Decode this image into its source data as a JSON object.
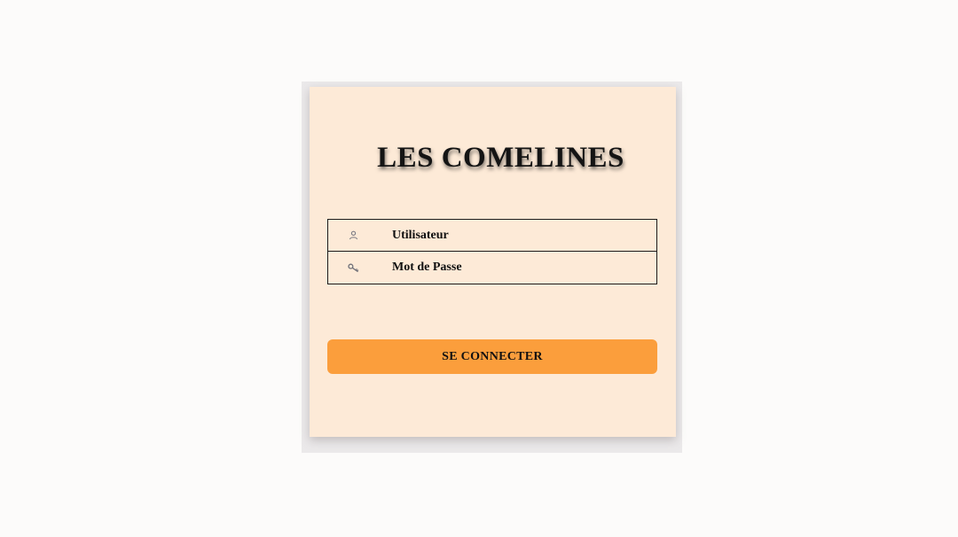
{
  "login": {
    "title": "LES COMELINES",
    "username": {
      "placeholder": "Utilisateur",
      "icon": "user-icon"
    },
    "password": {
      "placeholder": "Mot de Passe",
      "icon": "key-icon"
    },
    "submit_label": "SE CONNECTER"
  },
  "colors": {
    "page_background": "#fcfbfa",
    "frame": "#ebe9ea",
    "card": "#fdead7",
    "button": "#fb9e3c",
    "text": "#111111"
  }
}
